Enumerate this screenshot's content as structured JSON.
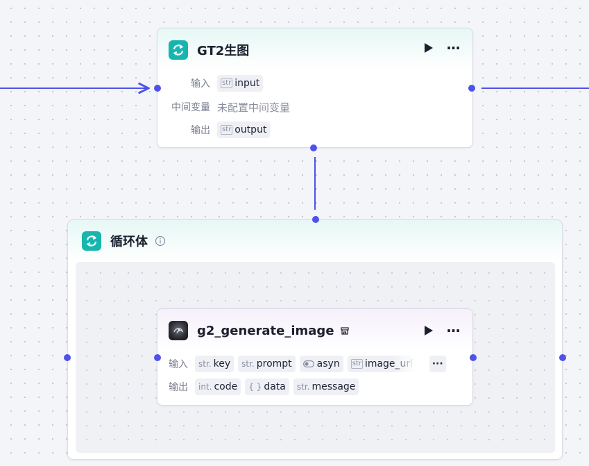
{
  "nodes": {
    "gt2": {
      "title": "GT2生图",
      "rows": {
        "input_label": "输入",
        "input_type": "str",
        "input_value": "input",
        "vars_label": "中间变量",
        "vars_value": "未配置中间变量",
        "output_label": "输出",
        "output_type": "str",
        "output_value": "output"
      }
    },
    "loop": {
      "title": "循环体"
    },
    "g2": {
      "title": "g2_generate_image",
      "input_label": "输入",
      "inputs": [
        {
          "type": "str.",
          "name": "key"
        },
        {
          "type": "str.",
          "name": "prompt"
        },
        {
          "type": "",
          "name": "asyn"
        },
        {
          "type": "str",
          "name": "image_url"
        }
      ],
      "more_label": "···",
      "output_label": "输出",
      "outputs": [
        {
          "type": "int.",
          "name": "code"
        },
        {
          "type": "{ }",
          "name": "data"
        },
        {
          "type": "str.",
          "name": "message"
        }
      ]
    }
  },
  "colors": {
    "accent": "#4d53e8",
    "icon_bg": "#16b6ae"
  },
  "icons": [
    "loop-icon",
    "play-icon",
    "more-icon",
    "info-icon",
    "plugin-avatar-icon",
    "store-icon",
    "toggle-icon"
  ]
}
